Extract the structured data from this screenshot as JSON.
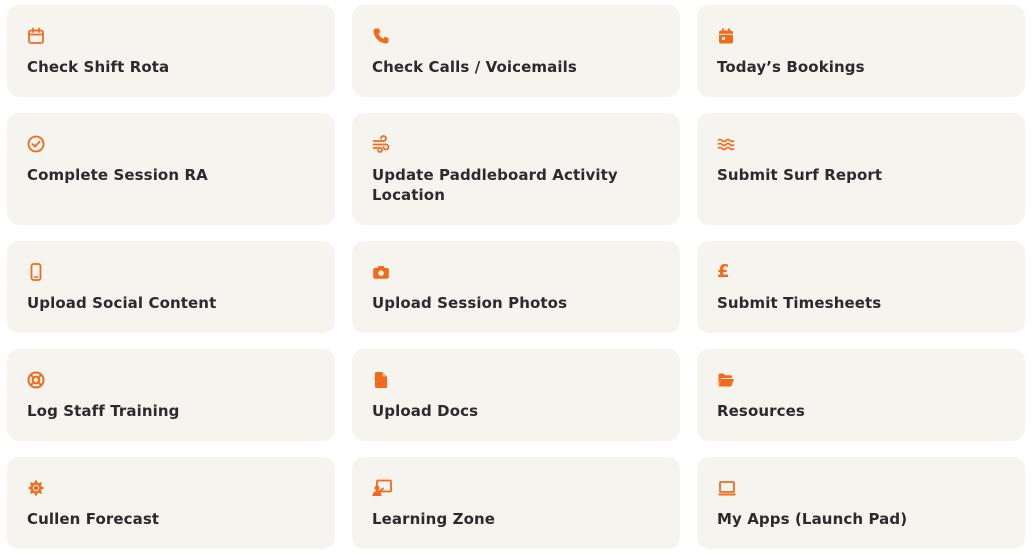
{
  "accent_color": "#f26b1d",
  "card_background": "#f6f4ef",
  "tiles": [
    {
      "label": "Check Shift Rota",
      "icon": "calendar-icon"
    },
    {
      "label": "Check Calls / Voicemails",
      "icon": "phone-icon"
    },
    {
      "label": "Today’s Bookings",
      "icon": "calendar-day-icon"
    },
    {
      "label": "Complete Session RA",
      "icon": "check-circle-icon"
    },
    {
      "label": "Update Paddleboard Activity Location",
      "icon": "wind-icon"
    },
    {
      "label": "Submit Surf Report",
      "icon": "waves-icon"
    },
    {
      "label": "Upload Social Content",
      "icon": "mobile-phone-icon"
    },
    {
      "label": "Upload Session Photos",
      "icon": "camera-icon"
    },
    {
      "label": "Submit Timesheets",
      "icon": "pound-sign-icon",
      "glyph": "£"
    },
    {
      "label": "Log Staff Training",
      "icon": "lifebuoy-icon"
    },
    {
      "label": "Upload Docs",
      "icon": "document-icon"
    },
    {
      "label": "Resources",
      "icon": "folder-open-icon"
    },
    {
      "label": "Cullen Forecast",
      "icon": "sun-icon"
    },
    {
      "label": "Learning Zone",
      "icon": "teacher-board-icon"
    },
    {
      "label": "My Apps (Launch Pad)",
      "icon": "laptop-icon"
    }
  ]
}
